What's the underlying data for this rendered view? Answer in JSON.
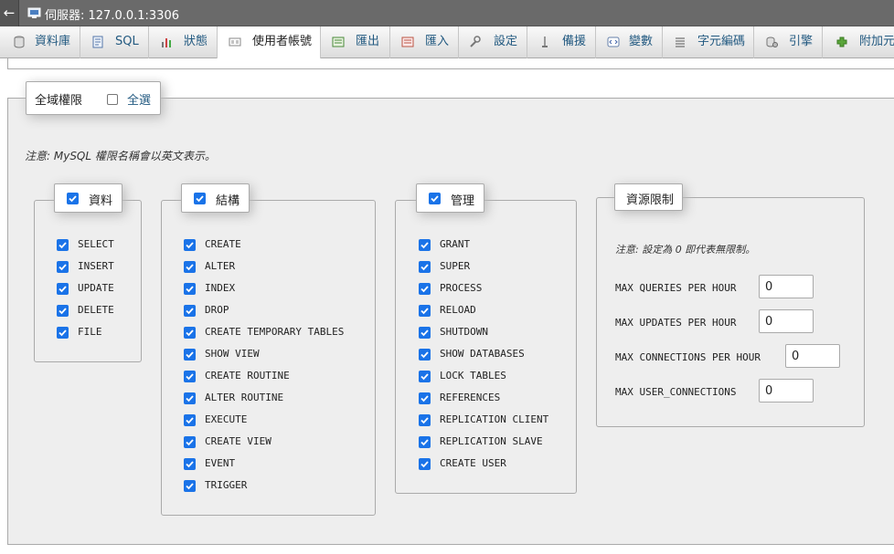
{
  "header": {
    "back_glyph": "←",
    "server_icon": "server-icon",
    "title": "伺服器: 127.0.0.1:3306"
  },
  "tabs": [
    {
      "label": "資料庫",
      "icon": "database-icon"
    },
    {
      "label": "SQL",
      "icon": "sql-icon"
    },
    {
      "label": "狀態",
      "icon": "status-icon"
    },
    {
      "label": "使用者帳號",
      "icon": "users-icon",
      "active": true
    },
    {
      "label": "匯出",
      "icon": "export-icon"
    },
    {
      "label": "匯入",
      "icon": "import-icon"
    },
    {
      "label": "設定",
      "icon": "settings-icon"
    },
    {
      "label": "備援",
      "icon": "replication-icon"
    },
    {
      "label": "變數",
      "icon": "variables-icon"
    },
    {
      "label": "字元編碼",
      "icon": "charset-icon"
    },
    {
      "label": "引擎",
      "icon": "engines-icon"
    },
    {
      "label": "附加元",
      "icon": "plugins-icon"
    }
  ],
  "global": {
    "legend": "全域權限",
    "select_all_label": "全選",
    "select_all_checked": false,
    "note": "注意: MySQL 權限名稱會以英文表示。"
  },
  "groups": {
    "data": {
      "title": "資料",
      "checked": true,
      "items": [
        "SELECT",
        "INSERT",
        "UPDATE",
        "DELETE",
        "FILE"
      ]
    },
    "structure": {
      "title": "結構",
      "checked": true,
      "items": [
        "CREATE",
        "ALTER",
        "INDEX",
        "DROP",
        "CREATE TEMPORARY TABLES",
        "SHOW VIEW",
        "CREATE ROUTINE",
        "ALTER ROUTINE",
        "EXECUTE",
        "CREATE VIEW",
        "EVENT",
        "TRIGGER"
      ]
    },
    "admin": {
      "title": "管理",
      "checked": true,
      "items": [
        "GRANT",
        "SUPER",
        "PROCESS",
        "RELOAD",
        "SHUTDOWN",
        "SHOW DATABASES",
        "LOCK TABLES",
        "REFERENCES",
        "REPLICATION CLIENT",
        "REPLICATION SLAVE",
        "CREATE USER"
      ]
    }
  },
  "limits": {
    "title": "資源限制",
    "note": "注意: 設定為 0 即代表無限制。",
    "fields": [
      {
        "label": "MAX QUERIES PER HOUR",
        "value": "0"
      },
      {
        "label": "MAX UPDATES PER HOUR",
        "value": "0"
      },
      {
        "label": "MAX CONNECTIONS PER HOUR",
        "value": "0"
      },
      {
        "label": "MAX USER_CONNECTIONS",
        "value": "0"
      }
    ]
  },
  "colors": {
    "accent": "#1a73e8",
    "link": "#235a81",
    "topbar": "#6a6a6a",
    "panel": "#eeeeee"
  }
}
